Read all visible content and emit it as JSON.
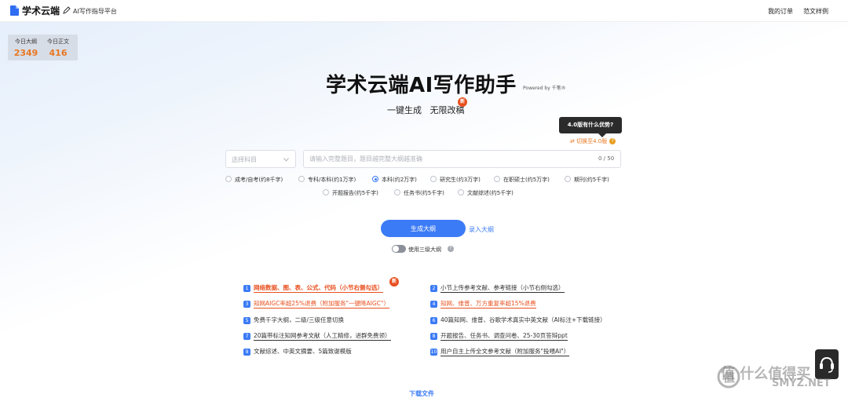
{
  "header": {
    "logo_text": "学术云端",
    "slogan": "AI写作指导平台",
    "nav": {
      "orders": "我的订单",
      "samples": "范文样例"
    }
  },
  "stats": [
    {
      "label": "今日大纲",
      "value": "2349"
    },
    {
      "label": "今日正文",
      "value": "416"
    }
  ],
  "hero": {
    "title": "学术云端AI写作助手",
    "powered": "Powered by 千笔®",
    "subtitle": "一键生成   无限改稿",
    "new_badge": "新"
  },
  "version": {
    "tooltip": "4.0版有什么优势?",
    "switch_label": "⇄ 切换至4.0版",
    "help": "?"
  },
  "form": {
    "subject_placeholder": "选择科目",
    "topic_placeholder": "请输入完整题目，题目越完整大纲越准确",
    "counter": "0 / 50",
    "degrees": [
      {
        "label": "成考/自考(约8千字)",
        "selected": false
      },
      {
        "label": "专科/本科(约1万字)",
        "selected": false
      },
      {
        "label": "本科(约2万字)",
        "selected": true
      },
      {
        "label": "研究生(约3万字)",
        "selected": false
      },
      {
        "label": "在职硕士(约5万字)",
        "selected": false
      },
      {
        "label": "期刊(约5千字)",
        "selected": false
      },
      {
        "label": "开题报告(约5千字)",
        "selected": false
      },
      {
        "label": "任务书(约5千字)",
        "selected": false
      },
      {
        "label": "文献综述(约5千字)",
        "selected": false
      }
    ],
    "generate_button": "生成大纲",
    "enter_outline": "录入大纲",
    "toggle_label": "使用三级大纲",
    "toggle_help": "?"
  },
  "features": [
    {
      "num": "1",
      "text": "网络数据、图、表、公式、代码（小节右侧勾选）",
      "style": "orange"
    },
    {
      "num": "2",
      "text": "小节上传参考文献、参考链接（小节右侧勾选）",
      "style": "dark"
    },
    {
      "num": "3",
      "text": "知网AIGC率超25%退费（附加服务\"一键降AIGC\"）",
      "style": "orange"
    },
    {
      "num": "4",
      "text": "知网、维普、万方重复率超15%退费",
      "style": "orange"
    },
    {
      "num": "5",
      "text": "免费千字大纲，二级/三级任意切换",
      "style": "dark"
    },
    {
      "num": "6",
      "text": "40篇知网、维普、谷歌学术真实中英文献（AI标注+下载链接）",
      "style": "dark"
    },
    {
      "num": "7",
      "text": "20篇带标注知网参考文献（人工精修，进群免费领）",
      "style": "dark"
    },
    {
      "num": "8",
      "text": "开题报告、任务书、调查问卷、25-30页答辩ppt",
      "style": "dark"
    },
    {
      "num": "9",
      "text": "文献综述、中英文摘要、5篇致谢模版",
      "style": "dark"
    },
    {
      "num": "10",
      "text": "用户自主上传全文参考文献（附加服务\"投喂AI\"）",
      "style": "dark"
    }
  ],
  "download": "下载文件",
  "watermark": {
    "cn": "值 什么值得买",
    "en": "SMYZ.NET"
  }
}
